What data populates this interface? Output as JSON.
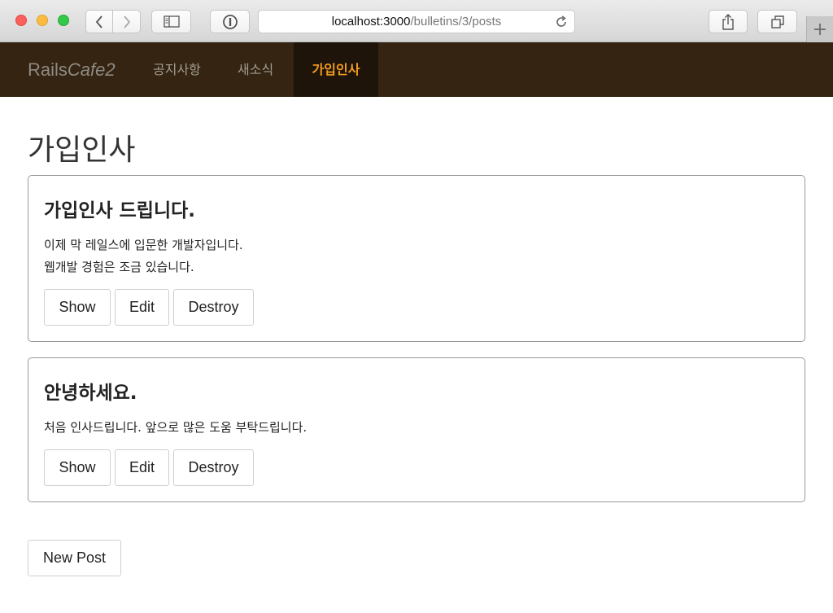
{
  "browser": {
    "address_host": "localhost:3000",
    "address_path": "/bulletins/3/posts",
    "new_tab_symbol": "+"
  },
  "navbar": {
    "brand_plain": "Rails",
    "brand_italic": "Cafe2",
    "items": [
      {
        "label": "공지사항"
      },
      {
        "label": "새소식"
      },
      {
        "label": "가입인사"
      }
    ],
    "active_color": "#f29b21",
    "background": "#342411"
  },
  "main": {
    "title": "가입인사",
    "posts": [
      {
        "title": "가입인사 드립니다.",
        "body_lines": [
          "이제 막 레일스에 입문한 개발자입니다.",
          "웹개발 경험은 조금 있습니다."
        ],
        "actions": {
          "show": "Show",
          "edit": "Edit",
          "destroy": "Destroy"
        }
      },
      {
        "title": "안녕하세요.",
        "body_lines": [
          "처음 인사드립니다. 앞으로 많은 도움 부탁드립니다."
        ],
        "actions": {
          "show": "Show",
          "edit": "Edit",
          "destroy": "Destroy"
        }
      }
    ],
    "new_post_label": "New Post"
  }
}
